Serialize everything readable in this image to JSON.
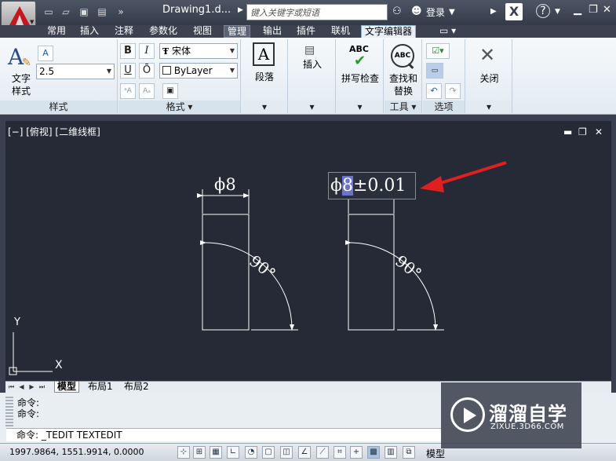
{
  "titlebar": {
    "doc_title": "Drawing1.d...",
    "search_placeholder": "键入关键字或短语",
    "login_label": "登录",
    "help_label": "?"
  },
  "tabs": [
    "常用",
    "插入",
    "注释",
    "参数化",
    "视图",
    "管理",
    "输出",
    "插件",
    "联机",
    "文字编辑器"
  ],
  "ribbon": {
    "style_panel": {
      "title": "样式",
      "text_style_label": "文字\n样式",
      "height_value": "2.5"
    },
    "format_panel": {
      "title": "格式 ▾",
      "bold": "B",
      "italic": "I",
      "underline": "U",
      "overline": "Ō",
      "font_value": "宋体",
      "color_value": "ByLayer"
    },
    "paragraph_panel": {
      "label": "段落"
    },
    "insert_panel": {
      "label": "插入"
    },
    "spell_panel": {
      "label": "拼写检查",
      "abc": "ABC"
    },
    "find_panel": {
      "label": "查找和\n替换",
      "abc": "ABC"
    },
    "tools_panel": {
      "title": "工具 ▾"
    },
    "options_panel": {
      "title": "选项"
    },
    "close_panel": {
      "label": "关闭"
    }
  },
  "viewport": {
    "label": "[−] [俯视] [二维线框]"
  },
  "drawing": {
    "dim_left": "ϕ8",
    "angle_left": "90°",
    "angle_right": "90°",
    "edit_prefix": "ϕ",
    "edit_selected": "8",
    "edit_suffix": "±0.01",
    "ucs_x": "X",
    "ucs_y": "Y"
  },
  "layout_tabs": [
    "模型",
    "布局1",
    "布局2"
  ],
  "command": {
    "line1": "命令:",
    "line2": "命令:",
    "input": "命令: _TEDIT TEXTEDIT"
  },
  "status": {
    "coords": "1997.9864, 1551.9914, 0.0000",
    "model": "模型"
  },
  "watermark": {
    "title": "溜溜自学",
    "url": "ZIXUE.3D66.COM"
  },
  "colors": {
    "canvas": "#252a36",
    "arrow": "#e02020",
    "highlight": "#6b74c7"
  }
}
